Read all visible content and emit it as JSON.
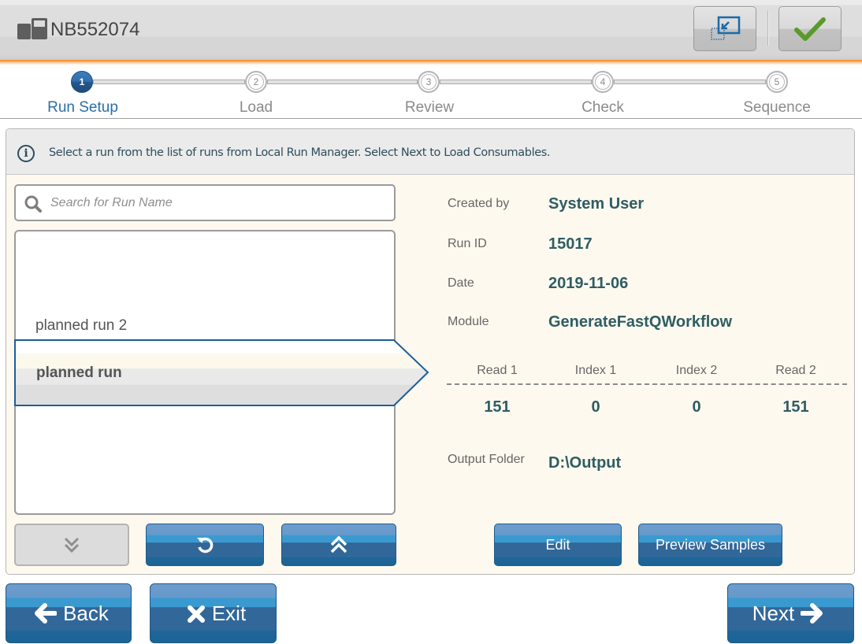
{
  "titlebar": {
    "instrument_icon": "instrument-icon",
    "instrument_name": "NB552074",
    "buttons": [
      {
        "name": "minimize",
        "icon": "minimize-window-icon"
      },
      {
        "name": "confirm",
        "icon": "checkmark-icon",
        "color": "#5a9a2a"
      }
    ],
    "accent_color": "#f08a2c"
  },
  "stepper": {
    "steps": [
      {
        "number": "1",
        "label": "Run Setup",
        "active": true
      },
      {
        "number": "2",
        "label": "Load",
        "active": false
      },
      {
        "number": "3",
        "label": "Review",
        "active": false
      },
      {
        "number": "4",
        "label": "Check",
        "active": false
      },
      {
        "number": "5",
        "label": "Sequence",
        "active": false
      }
    ],
    "active_color": "#2a6fa8"
  },
  "info": {
    "icon": "info-icon",
    "text": "Select a run from the list of runs from Local Run Manager. Select Next to Load Consumables."
  },
  "search": {
    "icon": "search-icon",
    "placeholder": "Search for Run Name",
    "value": ""
  },
  "runs": {
    "items": [
      {
        "label": "planned run 2",
        "selected": false
      },
      {
        "label": "planned run",
        "selected": true
      }
    ],
    "buttons": [
      {
        "name": "scroll-down",
        "icon": "double-chevron-down-icon",
        "enabled": false
      },
      {
        "name": "refresh",
        "icon": "refresh-icon",
        "enabled": true
      },
      {
        "name": "scroll-up",
        "icon": "double-chevron-up-icon",
        "enabled": true
      }
    ]
  },
  "details": {
    "created_by": {
      "label": "Created by",
      "value": "System User"
    },
    "run_id": {
      "label": "Run ID",
      "value": "15017"
    },
    "date": {
      "label": "Date",
      "value": "2019-11-06"
    },
    "module": {
      "label": "Module",
      "value": "GenerateFastQWorkflow"
    },
    "reads": [
      {
        "label": "Read 1",
        "value": "151"
      },
      {
        "label": "Index 1",
        "value": "0"
      },
      {
        "label": "Index 2",
        "value": "0"
      },
      {
        "label": "Read 2",
        "value": "151"
      }
    ],
    "output_folder": {
      "label": "Output Folder",
      "value": "D:\\Output"
    },
    "value_color": "#2f5d63",
    "edit_label": "Edit",
    "preview_label": "Preview Samples"
  },
  "nav": {
    "back_label": "Back",
    "exit_label": "Exit",
    "next_label": "Next",
    "button_color": "#32679a"
  }
}
